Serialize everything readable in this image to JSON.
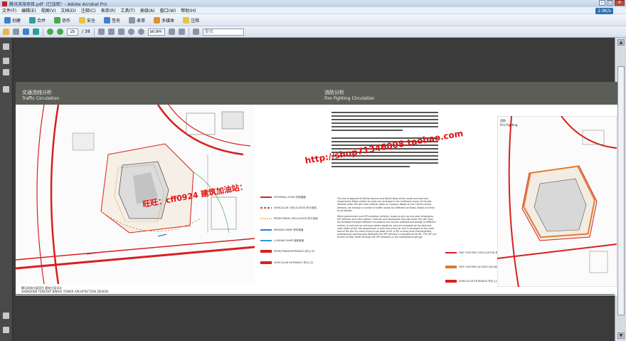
{
  "window": {
    "title": "腾讯滨海项目.pdf（已加密）- Adobe Acrobat Pro",
    "controls": [
      "–",
      "□",
      "✕"
    ]
  },
  "menubar": {
    "items": [
      "文件(F)",
      "编辑(E)",
      "视图(V)",
      "文档(D)",
      "注释(C)",
      "表单(R)",
      "工具(T)",
      "高级(A)",
      "窗口(W)",
      "帮助(H)"
    ]
  },
  "network_badge": "2.9K/s",
  "toolbar1": {
    "buttons": [
      {
        "label": "创建",
        "icon": "create-icon"
      },
      {
        "label": "合并",
        "icon": "merge-icon"
      },
      {
        "label": "协作",
        "icon": "collaborate-icon"
      },
      {
        "label": "安全",
        "icon": "security-lock-icon"
      },
      {
        "label": "签名",
        "icon": "sign-icon"
      },
      {
        "label": "表单",
        "icon": "forms-icon"
      },
      {
        "label": "多媒体",
        "icon": "multimedia-icon"
      },
      {
        "label": "注释",
        "icon": "comment-icon"
      }
    ]
  },
  "toolbar2": {
    "page_current": "25",
    "page_total": "/ 38",
    "zoom": "50.8%",
    "find_placeholder": "查找"
  },
  "document": {
    "left_title_cn": "交通流线分析",
    "left_title_en": "Traffic Circulation",
    "right_title_cn": "消防分析",
    "right_title_en": "Fire Fighting Circulation",
    "caption_cn": "腾讯滨海大厦项目 建筑方案设计",
    "caption_en": "SHENZHEN TENCENT BINHAI TOWER ARCHITECTURE DESIGN",
    "para_en": "The site is adjacent to Binhai Avenue and Baishi Road at the south and east and respectively. Major entries to roads are arranged in the northeast corner of the site. Vehicles enter the site from internal roads on campus. Based on the Client's actual demand, we arrange a number of traffic routes for different car flows, details of which as as follows:",
    "para_en2": "When government and VIP reception vehicles, buses to pick up and send employees, VIP vehicles and a few visitors' vehicles and employees' bicycles enter the site, they are diverged through different circulations and access underground garage in different entries, to exit and an entrance before goods for cars are arranged at the east and north sides of the site respectively. A dual-lane entry for cars is arranged at the north side of the site for small trucks to go down to B1 or B2 so busy time internal/public underground parking area dedicated for VIP vehicles is arranged at the B1. The VIP can access all floor levels through the VIP elevators in the underground garage.",
    "inset_label": "消防",
    "inset_label_en": "Fire Fighting"
  },
  "legend_left": [
    {
      "label": "EXTERNAL ROAD 外部道路",
      "color": "#d91f1f",
      "style": "solid"
    },
    {
      "label": "VEHICULAR CIRCULATION 车行流线",
      "color": "#d94a1f",
      "style": "dash"
    },
    {
      "label": "PEDESTRIAN CIRCULATION 步行流线",
      "color": "#e08a2a",
      "style": "dot"
    },
    {
      "label": "PARKING RAMP 停车坡道",
      "color": "#2a7ad9",
      "style": "arrow"
    },
    {
      "label": "LOADING RAMP 装卸坡道",
      "color": "#2a9ad9",
      "style": "arrow"
    },
    {
      "label": "PEDESTRIAN ENTRANCE 步行入口",
      "color": "#d91f1f",
      "style": "tri"
    },
    {
      "label": "VEHICULAR ENTRANCE 车行入口",
      "color": "#d91f1f",
      "style": "tri"
    }
  ],
  "legend_right": [
    {
      "label": "FIRE FIGHTING CIRCULATION 消防车道",
      "color": "#d91f1f",
      "style": "solid"
    },
    {
      "label": "FIRE FIGHTING ACCESS FACADE 消防登高面",
      "color": "#e07a2a",
      "style": "thick"
    },
    {
      "label": "VEHICULAR ENTRANCE 车行入口",
      "color": "#d91f1f",
      "style": "tri"
    }
  ],
  "watermarks": [
    "http://shop71346008.taobao.com",
    "旺旺：cff0924 建筑加油站："
  ],
  "colors": {
    "accent_red": "#d91f1f",
    "band": "#5b5d57"
  }
}
